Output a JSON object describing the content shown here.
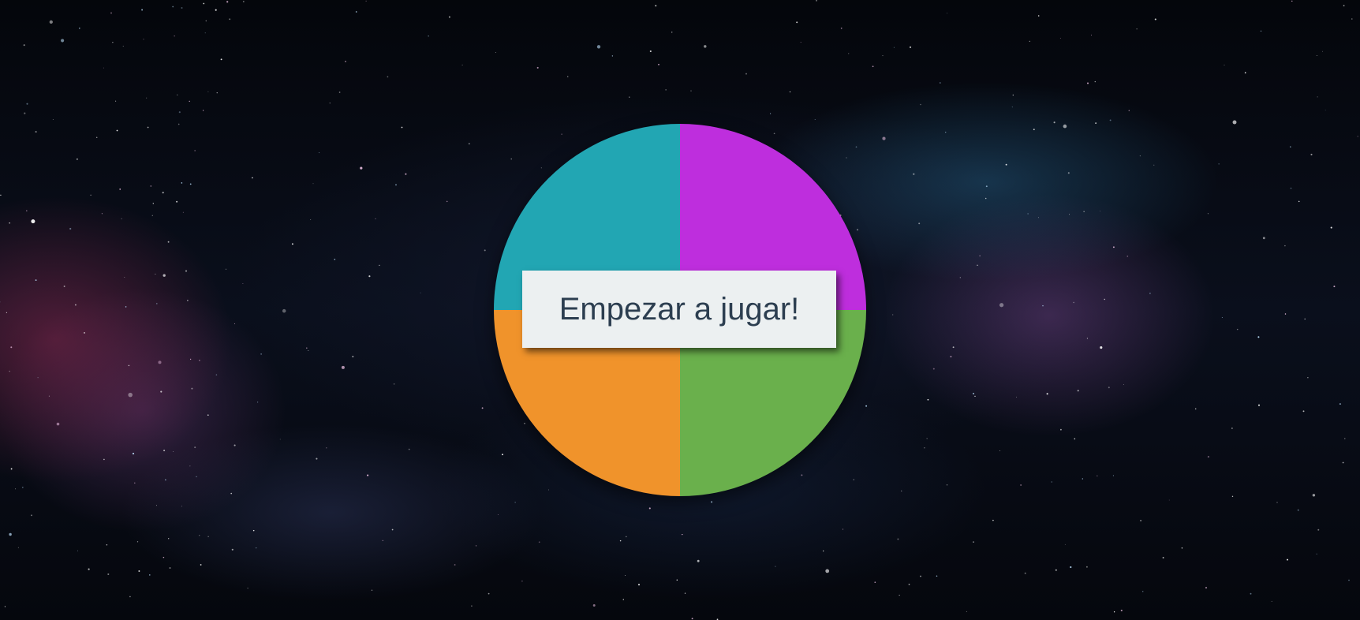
{
  "game": {
    "start_button_label": "Empezar a jugar!",
    "quadrants": [
      {
        "position": "top-left",
        "color": "#22A6B3"
      },
      {
        "position": "top-right",
        "color": "#BE2EDD"
      },
      {
        "position": "bottom-left",
        "color": "#F0932B"
      },
      {
        "position": "bottom-right",
        "color": "#6AB04C"
      }
    ]
  },
  "colors": {
    "button_background": "#ECF0F1",
    "button_text": "#2C3E50"
  }
}
